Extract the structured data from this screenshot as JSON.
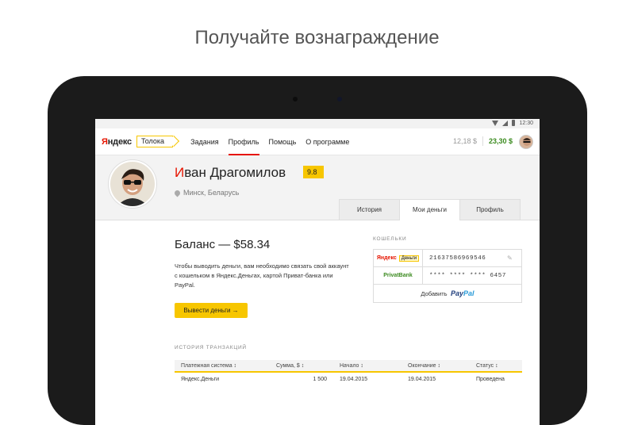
{
  "headline": "Получайте вознаграждение",
  "statusbar": {
    "time": "12:30"
  },
  "nav": {
    "logo": {
      "prefix": "Я",
      "rest": "ндекс"
    },
    "product": "Толока",
    "links": [
      {
        "label": "Задания",
        "active": false
      },
      {
        "label": "Профиль",
        "active": true
      },
      {
        "label": "Помощь",
        "active": false
      },
      {
        "label": "О программе",
        "active": false
      }
    ],
    "balance_pending": "12,18 $",
    "balance_available": "23,30 $"
  },
  "profile": {
    "name_first_letter": "И",
    "name_rest": "ван Драгомилов",
    "rating": "9.8",
    "location": "Минск, Беларусь",
    "tabs": [
      {
        "label": "История",
        "active": false
      },
      {
        "label": "Мои деньги",
        "active": true
      },
      {
        "label": "Профиль",
        "active": false
      }
    ]
  },
  "money": {
    "balance_title": "Баланс — $58.34",
    "description": "Чтобы выводить деньги, вам необходимо связать свой аккаунт с кошельком в Яндекс.Деньгах, картой Приват-банка или PayPal.",
    "withdraw_button": "Вывести деньги →"
  },
  "wallets": {
    "label": "КОШЕЛЬКИ",
    "yandex": {
      "logo": "Яндекс",
      "badge": "Деньги",
      "number": "21637586969546"
    },
    "privat": {
      "logo": "PrivatBank",
      "number": "**** **** **** 6457"
    },
    "add_label": "Добавить",
    "paypal_a": "Pay",
    "paypal_b": "Pal"
  },
  "transactions": {
    "label": "ИСТОРИЯ ТРАНЗАКЦИЙ",
    "columns": [
      "Платежная система  ↕",
      "Сумма, $  ↕",
      "Начало  ↕",
      "Окончание  ↕",
      "Статус  ↕"
    ],
    "rows": [
      [
        "Яндекс.Деньги",
        "1 500",
        "19.04.2015",
        "19.04.2015",
        "Проведена"
      ]
    ]
  },
  "colors": {
    "accent": "#f7c600",
    "brand_red": "#e61400",
    "green": "#3a8a1e"
  }
}
